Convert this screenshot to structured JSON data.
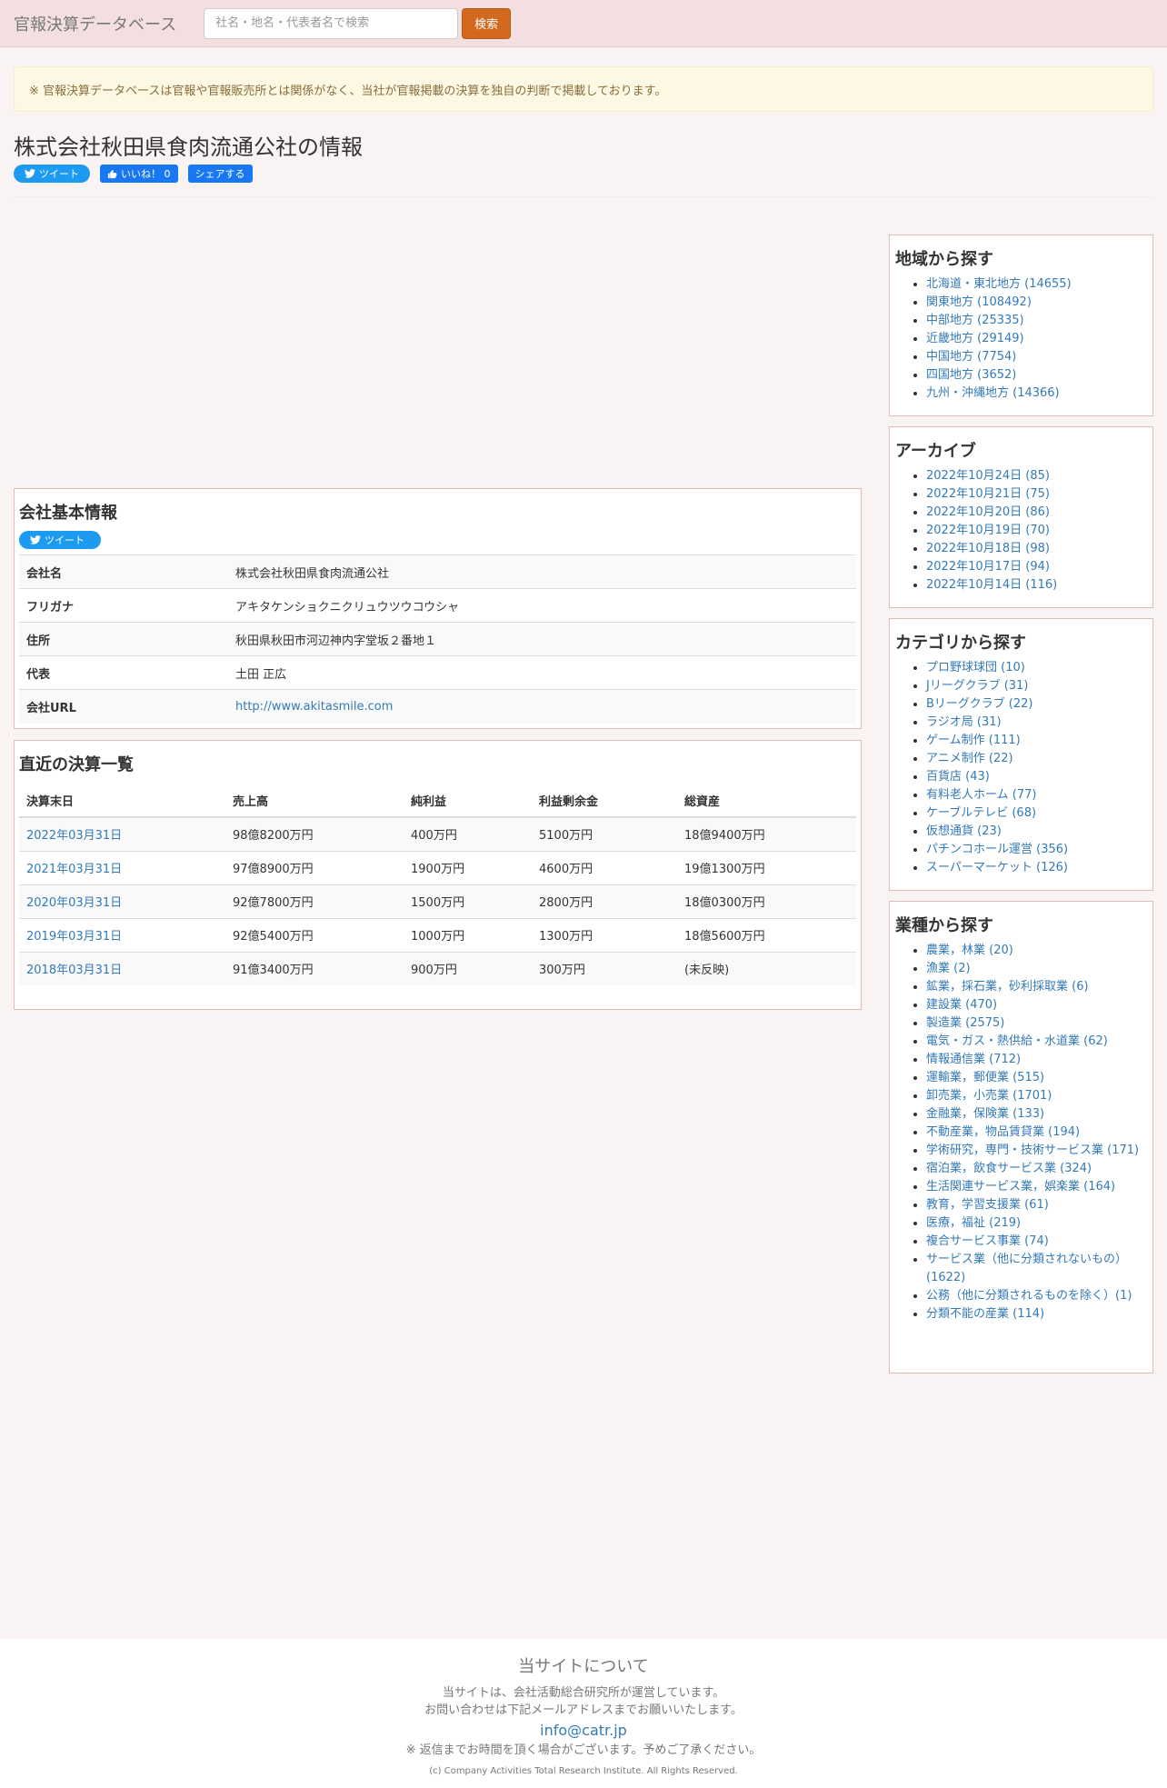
{
  "nav": {
    "brand": "官報決算データベース",
    "search_placeholder": "社名・地名・代表者名で検索",
    "search_button": "検索"
  },
  "notice": "※ 官報決算データベースは官報や官報販売所とは関係がなく、当社が官報掲載の決算を独自の判断で掲載しております。",
  "page_title": "株式会社秋田県食肉流通公社の情報",
  "social": {
    "tweet": "ツイート",
    "like": "いいね！ 0",
    "share": "シェアする"
  },
  "company": {
    "heading": "会社基本情報",
    "tweet": "ツイート",
    "rows": [
      {
        "label": "会社名",
        "value": "株式会社秋田県食肉流通公社"
      },
      {
        "label": "フリガナ",
        "value": "アキタケンショクニクリュウツウコウシャ"
      },
      {
        "label": "住所",
        "value": "秋田県秋田市河辺神内字堂坂２番地１"
      },
      {
        "label": "代表",
        "value": "土田 正広"
      },
      {
        "label": "会社URL",
        "value": "http://www.akitasmile.com"
      }
    ]
  },
  "financials": {
    "heading": "直近の決算一覧",
    "columns": [
      "決算末日",
      "売上高",
      "純利益",
      "利益剰余金",
      "総資産"
    ],
    "rows": [
      [
        "2022年03月31日",
        "98億8200万円",
        "400万円",
        "5100万円",
        "18億9400万円"
      ],
      [
        "2021年03月31日",
        "97億8900万円",
        "1900万円",
        "4600万円",
        "19億1300万円"
      ],
      [
        "2020年03月31日",
        "92億7800万円",
        "1500万円",
        "2800万円",
        "18億0300万円"
      ],
      [
        "2019年03月31日",
        "92億5400万円",
        "1000万円",
        "1300万円",
        "18億5600万円"
      ],
      [
        "2018年03月31日",
        "91億3400万円",
        "900万円",
        "300万円",
        "(未反映)"
      ]
    ]
  },
  "sidebar": {
    "region": {
      "heading": "地域から探す",
      "items": [
        "北海道・東北地方 (14655)",
        "関東地方 (108492)",
        "中部地方 (25335)",
        "近畿地方 (29149)",
        "中国地方 (7754)",
        "四国地方 (3652)",
        "九州・沖縄地方 (14366)"
      ]
    },
    "archive": {
      "heading": "アーカイブ",
      "items": [
        "2022年10月24日 (85)",
        "2022年10月21日 (75)",
        "2022年10月20日 (86)",
        "2022年10月19日 (70)",
        "2022年10月18日 (98)",
        "2022年10月17日 (94)",
        "2022年10月14日 (116)"
      ]
    },
    "category": {
      "heading": "カテゴリから探す",
      "items": [
        "プロ野球球団 (10)",
        "Jリーグクラブ (31)",
        "Bリーグクラブ (22)",
        "ラジオ局 (31)",
        "ゲーム制作 (111)",
        "アニメ制作 (22)",
        "百貨店 (43)",
        "有料老人ホーム (77)",
        "ケーブルテレビ (68)",
        "仮想通貨 (23)",
        "パチンコホール運営 (356)",
        "スーパーマーケット (126)"
      ]
    },
    "industry": {
      "heading": "業種から探す",
      "items": [
        "農業，林業 (20)",
        "漁業 (2)",
        "鉱業，採石業，砂利採取業 (6)",
        "建設業 (470)",
        "製造業 (2575)",
        "電気・ガス・熱供給・水道業 (62)",
        "情報通信業 (712)",
        "運輸業，郵便業 (515)",
        "卸売業，小売業 (1701)",
        "金融業，保険業 (133)",
        "不動産業，物品賃貸業 (194)",
        "学術研究，専門・技術サービス業 (171)",
        "宿泊業，飲食サービス業 (324)",
        "生活関連サービス業，娯楽業 (164)",
        "教育，学習支援業 (61)",
        "医療，福祉 (219)",
        "複合サービス事業 (74)",
        "サービス業（他に分類されないもの）(1622)",
        "公務（他に分類されるものを除く）(1)",
        "分類不能の産業 (114)"
      ]
    }
  },
  "footer": {
    "heading": "当サイトについて",
    "line1": "当サイトは、会社活動総合研究所が運営しています。",
    "line2": "お問い合わせは下記メールアドレスまでお願いいたします。",
    "email": "info@catr.jp",
    "note": "※ 返信までお時間を頂く場合がございます。予めご了承ください。",
    "copyright": "(c) Company Activities Total Research Institute. All Rights Reserved."
  }
}
